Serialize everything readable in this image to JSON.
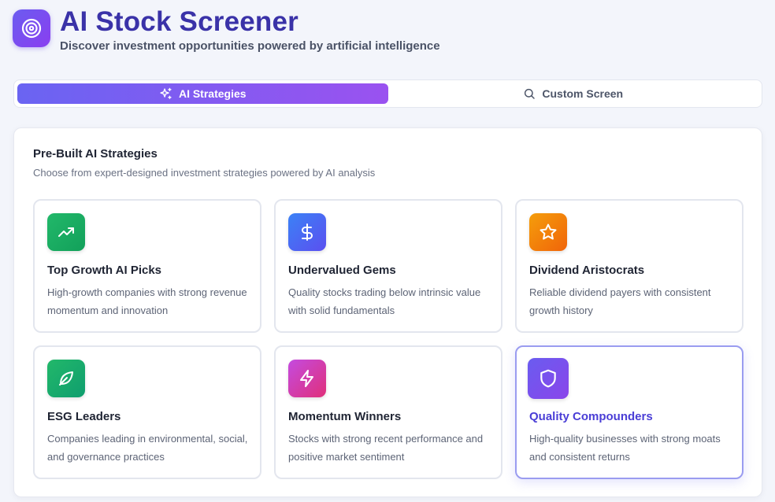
{
  "header": {
    "title": "AI Stock Screener",
    "subtitle": "Discover investment opportunities powered by artificial intelligence",
    "logo_icon": "target-icon"
  },
  "tabs": [
    {
      "label": "AI Strategies",
      "icon": "sparkles-icon",
      "active": true
    },
    {
      "label": "Custom Screen",
      "icon": "search-icon",
      "active": false
    }
  ],
  "panel": {
    "title": "Pre-Built AI Strategies",
    "description": "Choose from expert-designed investment strategies powered by AI analysis"
  },
  "strategies": [
    {
      "title": "Top Growth AI Picks",
      "description": "High-growth companies with strong revenue momentum and innovation",
      "icon": "trending-up-icon",
      "gradient": [
        "#22b86a",
        "#12a05a"
      ]
    },
    {
      "title": "Undervalued Gems",
      "description": "Quality stocks trading below intrinsic value with solid fundamentals",
      "icon": "dollar-icon",
      "gradient": [
        "#3b82f6",
        "#5b4ff0"
      ]
    },
    {
      "title": "Dividend Aristocrats",
      "description": "Reliable dividend payers with consistent growth history",
      "icon": "star-icon",
      "gradient": [
        "#f59e0b",
        "#f0640a"
      ]
    },
    {
      "title": "ESG Leaders",
      "description": "Companies leading in environmental, social, and governance practices",
      "icon": "leaf-icon",
      "gradient": [
        "#22b86a",
        "#0f9e6e"
      ]
    },
    {
      "title": "Momentum Winners",
      "description": "Stocks with strong recent performance and positive market sentiment",
      "icon": "lightning-icon",
      "gradient": [
        "#c44be0",
        "#e0307a"
      ]
    },
    {
      "title": "Quality Compounders",
      "description": "High-quality businesses with strong moats and consistent returns",
      "icon": "shield-icon",
      "gradient": [
        "#6a5cf0",
        "#8a45ea"
      ],
      "selected": true
    }
  ]
}
